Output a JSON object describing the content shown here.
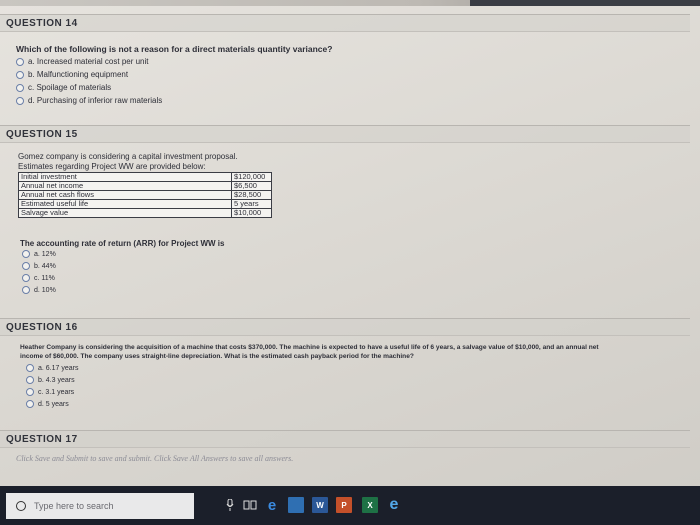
{
  "q14": {
    "heading": "QUESTION 14",
    "question": "Which of the following is not a reason for a direct materials quantity variance?",
    "options": [
      "a. Increased material cost per unit",
      "b. Malfunctioning equipment",
      "c. Spoilage of materials",
      "d. Purchasing of inferior raw materials"
    ]
  },
  "q15": {
    "heading": "QUESTION 15",
    "intro_line1": "Gomez company is considering a capital investment proposal.",
    "intro_line2": "Estimates regarding Project WW are provided below:",
    "table": [
      [
        "Initial investment",
        "$120,000"
      ],
      [
        "Annual net income",
        "$6,500"
      ],
      [
        "Annual net cash flows",
        "$28,500"
      ],
      [
        "Estimated useful life",
        "5 years"
      ],
      [
        "Salvage value",
        "$10,000"
      ]
    ],
    "question": "The accounting rate of return (ARR) for Project WW is",
    "options": [
      "a. 12%",
      "b. 44%",
      "c. 11%",
      "d. 10%"
    ]
  },
  "q16": {
    "heading": "QUESTION 16",
    "line1": "Heather Company is considering the acquisition of a machine that costs $370,000. The machine is expected to have a useful life of 6 years, a salvage value of $10,000, and an annual net",
    "line2": "income of $60,000. The company uses straight-line depreciation. What is the estimated cash payback period for the machine?",
    "options": [
      "a. 6.17 years",
      "b. 4.3 years",
      "c. 3.1 years",
      "d. 5 years"
    ]
  },
  "q17": {
    "heading": "QUESTION 17"
  },
  "save_line": "Click Save and Submit to save and submit. Click Save All Answers to save all answers.",
  "taskbar": {
    "search_placeholder": "Type here to search",
    "icons": [
      "microphone-icon",
      "task-view-icon",
      "edge-icon",
      "store-icon",
      "word-icon",
      "powerpoint-icon",
      "excel-icon",
      "ie-icon"
    ]
  }
}
